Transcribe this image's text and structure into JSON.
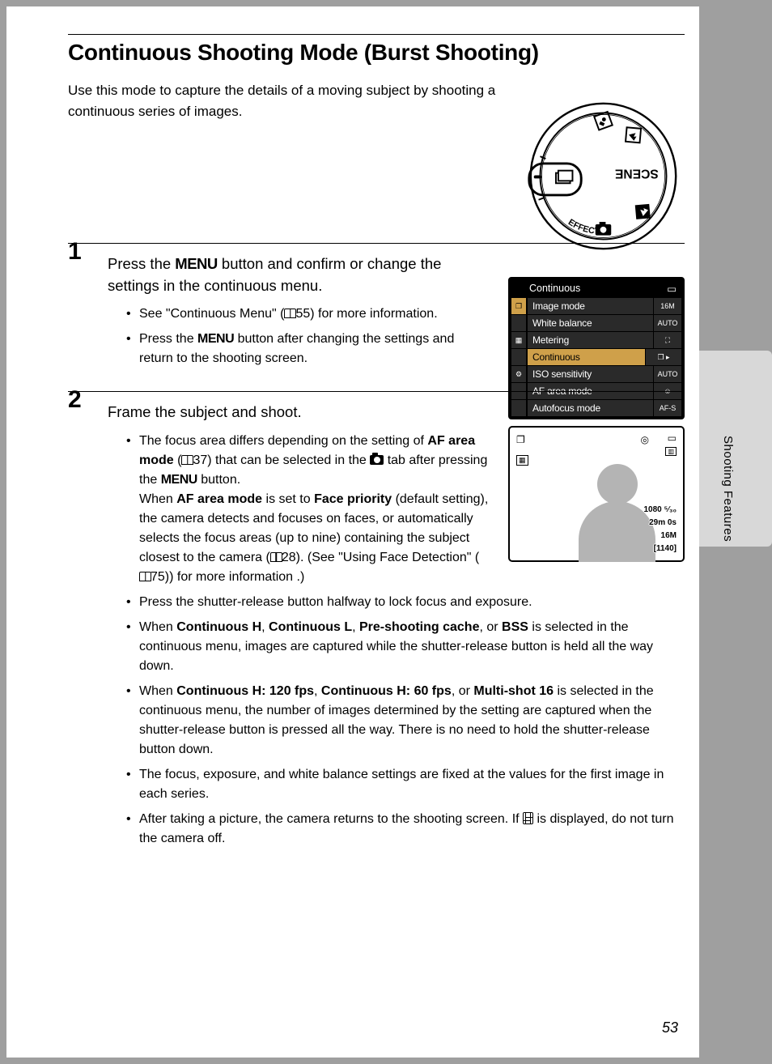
{
  "side_tab": "Shooting Features",
  "title": "Continuous Shooting Mode (Burst Shooting)",
  "intro": "Use this mode to capture the details of a moving subject by shooting a continuous series of images.",
  "dial_labels": {
    "scene": "SCENE",
    "effects": "EFFECTS"
  },
  "step1": {
    "num": "1",
    "h_pre": "Press the ",
    "h_menu": "MENU",
    "h_post": " button and confirm or change the settings in the continuous menu.",
    "b1_pre": "See \"Continuous Menu\" (",
    "b1_ref": "55",
    "b1_post": ") for more information.",
    "b2_pre": "Press the ",
    "b2_menu": "MENU",
    "b2_post": " button after changing the settings and return to the shooting screen."
  },
  "step2": {
    "num": "2",
    "h": "Frame the subject and shoot.",
    "b1_p1": "The focus area differs depending on the setting of ",
    "b1_af": "AF area mode",
    "b1_p2": " (",
    "b1_ref1": "37",
    "b1_p3": ") that can be selected in the ",
    "b1_p4": " tab after pressing the ",
    "b1_menu": "MENU",
    "b1_p5": " button.",
    "b1_p6": "When ",
    "b1_af2": "AF area mode",
    "b1_p7": " is set to ",
    "b1_fp": "Face priority",
    "b1_p8": " (default setting), the camera detects and focuses on faces, or automatically selects the focus areas (up to nine) containing the subject closest to the camera (",
    "b1_ref2": "28",
    "b1_p9": "). (See \"Using Face Detection\" (",
    "b1_ref3": "75",
    "b1_p10": ")) for more information .)",
    "b2": "Press the shutter-release button halfway to lock focus and exposure.",
    "b3_p1": "When ",
    "b3_ch": "Continuous H",
    "b3_c": ", ",
    "b3_cl": "Continuous L",
    "b3_psc": "Pre-shooting cache",
    "b3_or": ", or ",
    "b3_bss": "BSS",
    "b3_p2": " is selected in the continuous menu, images are captured while the shutter-release button is held all the way down.",
    "b4_p1": "When ",
    "b4_a": "Continuous H: 120 fps",
    "b4_b": "Continuous H: 60 fps",
    "b4_c2": "Multi-shot 16",
    "b4_p2": " is selected in the continuous menu, the number of images determined by the setting are captured when the shutter-release button is pressed all the way. There is no need to hold the shutter-release button down.",
    "b5": "The focus, exposure, and white balance settings are fixed at the values for the first image in each series.",
    "b6_p1": "After taking a picture, the camera returns to the shooting screen. If ",
    "b6_p2": " is displayed, do not turn the camera off."
  },
  "menu": {
    "title": "Continuous",
    "rows": [
      {
        "label": "Image mode",
        "val": "16M"
      },
      {
        "label": "White balance",
        "val": "AUTO"
      },
      {
        "label": "Metering",
        "val": "⛶"
      },
      {
        "label": "Continuous",
        "val": "❐ ▸"
      },
      {
        "label": "ISO sensitivity",
        "val": "AUTO"
      },
      {
        "label": "AF area mode",
        "val": "☺"
      },
      {
        "label": "Autofocus mode",
        "val": "AF-S"
      }
    ]
  },
  "lcd": {
    "movie": "1080 ⁵⁄₃₀",
    "time": "29m 0s",
    "size": "16M",
    "count": "[1140]"
  },
  "pagenum": "53"
}
